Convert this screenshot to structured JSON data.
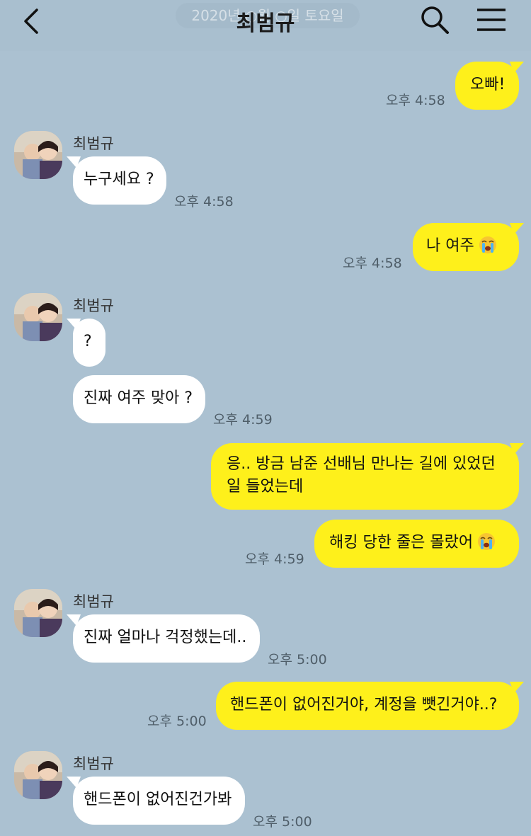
{
  "header": {
    "title": "최범규",
    "date_ghost": "2020년 ○월 ○일 토요일"
  },
  "contact": {
    "name": "최범규"
  },
  "messages": [
    {
      "from": "me",
      "text": "오빠!",
      "time": "오후 4:58"
    },
    {
      "from": "other",
      "text": "누구세요 ?",
      "time": "오후 4:58"
    },
    {
      "from": "me",
      "text": "나 여주",
      "emoji": "loudly-crying-face",
      "time": "오후 4:58"
    },
    {
      "from": "other",
      "text": "?"
    },
    {
      "from": "other",
      "text": "진짜 여주 맞아 ?",
      "time": "오후 4:59"
    },
    {
      "from": "me",
      "text_line1": "응.. 방금 남준 선배님 만나는 길에 있었던",
      "text_line2": "일 들었는데"
    },
    {
      "from": "me",
      "text": "해킹 당한 줄은 몰랐어",
      "emoji": "loudly-crying-face",
      "time": "오후 4:59"
    },
    {
      "from": "other",
      "text": "진짜 얼마나 걱정했는데..",
      "time": "오후 5:00"
    },
    {
      "from": "me",
      "text": "핸드폰이 없어진거야, 계정을 뺏긴거야..?",
      "time": "오후 5:00"
    },
    {
      "from": "other",
      "text": "핸드폰이 없어진건가봐",
      "time": "오후 5:00"
    }
  ],
  "colors": {
    "background": "#abc1d1",
    "my_bubble": "#fef01b",
    "other_bubble": "#ffffff"
  }
}
